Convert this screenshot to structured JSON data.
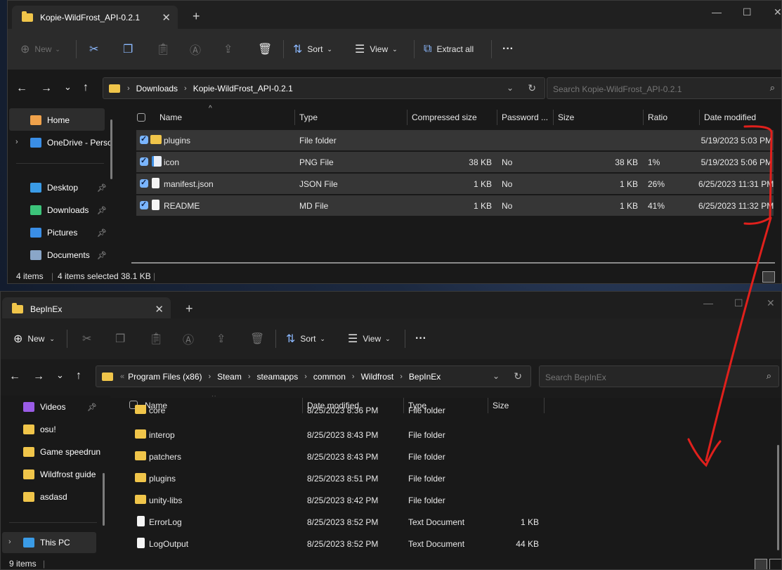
{
  "top_window": {
    "tab_title": "Kopie-WildFrost_API-0.2.1",
    "toolbar": {
      "new_label": "New",
      "sort_label": "Sort",
      "view_label": "View",
      "extract_label": "Extract all",
      "more_label": "···"
    },
    "breadcrumb": [
      "Downloads",
      "Kopie-WildFrost_API-0.2.1"
    ],
    "search_placeholder": "Search Kopie-WildFrost_API-0.2.1",
    "sidebar": [
      {
        "label": "Home",
        "icon": "home-icon",
        "color": "#f0a24b"
      },
      {
        "label": "OneDrive - Perso",
        "icon": "cloud-icon",
        "color": "#3a8ee6"
      },
      {
        "label": "Desktop",
        "icon": "desktop-icon",
        "color": "#3a9be6"
      },
      {
        "label": "Downloads",
        "icon": "download-icon",
        "color": "#3cc47a"
      },
      {
        "label": "Pictures",
        "icon": "pictures-icon",
        "color": "#3a8ee6"
      },
      {
        "label": "Documents",
        "icon": "documents-icon",
        "color": "#8aa6c8"
      }
    ],
    "columns": [
      "Name",
      "Type",
      "Compressed size",
      "Password ...",
      "Size",
      "Ratio",
      "Date modified"
    ],
    "rows": [
      {
        "name": "plugins",
        "type": "File folder",
        "compressed": "",
        "password": "",
        "size": "",
        "ratio": "",
        "date": "5/19/2023 5:03 PM",
        "kind": "folder"
      },
      {
        "name": "icon",
        "type": "PNG File",
        "compressed": "38 KB",
        "password": "No",
        "size": "38 KB",
        "ratio": "1%",
        "date": "5/19/2023 5:06 PM",
        "kind": "image"
      },
      {
        "name": "manifest.json",
        "type": "JSON File",
        "compressed": "1 KB",
        "password": "No",
        "size": "1 KB",
        "ratio": "26%",
        "date": "6/25/2023 11:31 PM",
        "kind": "doc"
      },
      {
        "name": "README",
        "type": "MD File",
        "compressed": "1 KB",
        "password": "No",
        "size": "1 KB",
        "ratio": "41%",
        "date": "6/25/2023 11:32 PM",
        "kind": "doc"
      }
    ],
    "status": {
      "items": "4 items",
      "selected": "4 items selected",
      "size": "38.1 KB"
    }
  },
  "bottom_window": {
    "tab_title": "BepInEx",
    "toolbar": {
      "new_label": "New",
      "sort_label": "Sort",
      "view_label": "View",
      "more_label": "···"
    },
    "breadcrumb": [
      "Program Files (x86)",
      "Steam",
      "steamapps",
      "common",
      "Wildfrost",
      "BepInEx"
    ],
    "search_placeholder": "Search BepInEx",
    "sidebar": [
      {
        "label": "Videos",
        "icon": "videos-icon",
        "color": "#9a5ce6"
      },
      {
        "label": "osu!",
        "icon": "folder-icon",
        "color": "#f0c54a"
      },
      {
        "label": "Game speedrun",
        "icon": "folder-icon",
        "color": "#f0c54a"
      },
      {
        "label": "Wildfrost guide",
        "icon": "folder-icon",
        "color": "#f0c54a"
      },
      {
        "label": "asdasd",
        "icon": "folder-icon",
        "color": "#f0c54a"
      },
      {
        "label": "This PC",
        "icon": "pc-icon",
        "color": "#3a9be6"
      }
    ],
    "columns": [
      "Name",
      "Date modified",
      "Type",
      "Size"
    ],
    "rows": [
      {
        "name": "core",
        "date": "8/25/2023 8:36 PM",
        "type": "File folder",
        "size": "",
        "kind": "folder"
      },
      {
        "name": "interop",
        "date": "8/25/2023 8:43 PM",
        "type": "File folder",
        "size": "",
        "kind": "folder"
      },
      {
        "name": "patchers",
        "date": "8/25/2023 8:43 PM",
        "type": "File folder",
        "size": "",
        "kind": "folder"
      },
      {
        "name": "plugins",
        "date": "8/25/2023 8:51 PM",
        "type": "File folder",
        "size": "",
        "kind": "folder"
      },
      {
        "name": "unity-libs",
        "date": "8/25/2023 8:42 PM",
        "type": "File folder",
        "size": "",
        "kind": "folder"
      },
      {
        "name": "ErrorLog",
        "date": "8/25/2023 8:52 PM",
        "type": "Text Document",
        "size": "1 KB",
        "kind": "doc"
      },
      {
        "name": "LogOutput",
        "date": "8/25/2023 8:52 PM",
        "type": "Text Document",
        "size": "44 KB",
        "kind": "doc"
      }
    ],
    "status": {
      "items": "9 items"
    }
  },
  "annotation": {
    "color": "#e0201c"
  }
}
